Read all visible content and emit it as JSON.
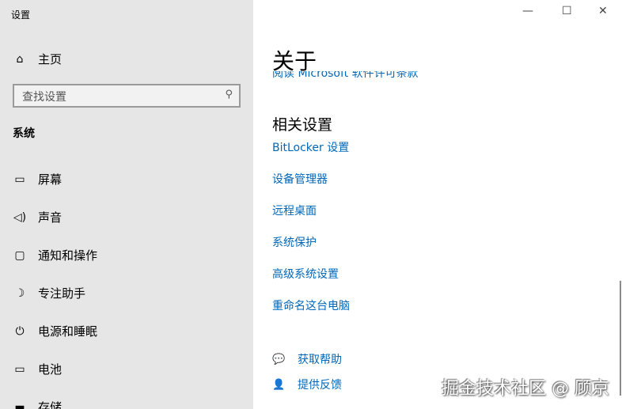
{
  "app_title": "设置",
  "sidebar": {
    "home": "主页",
    "search_placeholder": "查找设置",
    "section": "系统",
    "items": [
      {
        "label": "屏幕",
        "icon": "monitor-icon"
      },
      {
        "label": "声音",
        "icon": "speaker-icon"
      },
      {
        "label": "通知和操作",
        "icon": "notification-icon"
      },
      {
        "label": "专注助手",
        "icon": "moon-icon"
      },
      {
        "label": "电源和睡眠",
        "icon": "power-icon"
      },
      {
        "label": "电池",
        "icon": "battery-icon"
      },
      {
        "label": "存储",
        "icon": "storage-icon"
      }
    ]
  },
  "main": {
    "title": "关于",
    "clipped_link": "阅读 Microsoft 软件许可条款",
    "related_title": "相关设置",
    "links": [
      "BitLocker 设置",
      "设备管理器",
      "远程桌面",
      "系统保护",
      "高级系统设置",
      "重命名这台电脑"
    ],
    "help": "获取帮助",
    "feedback": "提供反馈"
  },
  "watermark": "掘金技术社区 @ 顾京"
}
